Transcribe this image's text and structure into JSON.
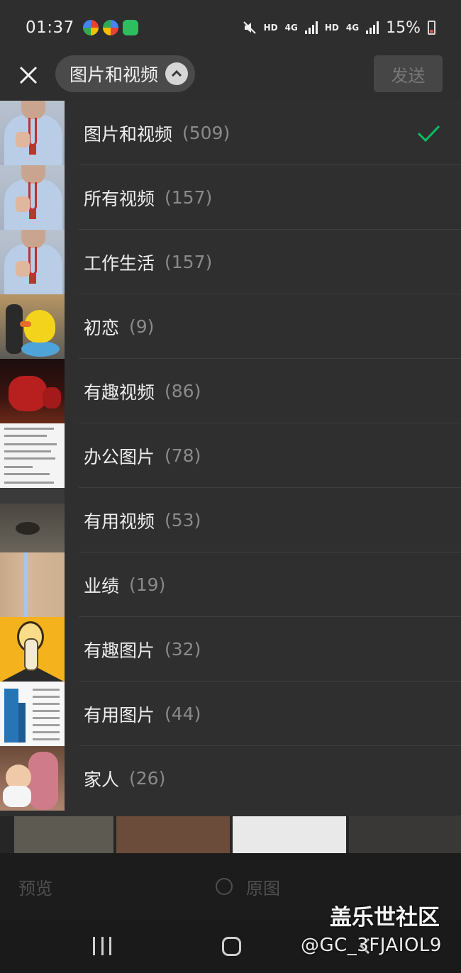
{
  "status_bar": {
    "time": "01:37",
    "sig1": "HD",
    "net1": "4G",
    "sig2": "HD",
    "net2": "4G",
    "battery": "15%"
  },
  "header": {
    "album_selector_label": "图片和视频",
    "send_label": "发送"
  },
  "albums": [
    {
      "name": "图片和视频",
      "count": "(509)",
      "selected": true,
      "thumb": "person"
    },
    {
      "name": "所有视频",
      "count": "(157)",
      "selected": false,
      "thumb": "person"
    },
    {
      "name": "工作生活",
      "count": "(157)",
      "selected": false,
      "thumb": "person"
    },
    {
      "name": "初恋",
      "count": "(9)",
      "selected": false,
      "thumb": "duck"
    },
    {
      "name": "有趣视频",
      "count": "(86)",
      "selected": false,
      "thumb": "spiderman"
    },
    {
      "name": "办公图片",
      "count": "(78)",
      "selected": false,
      "thumb": "document"
    },
    {
      "name": "有用视频",
      "count": "(53)",
      "selected": false,
      "thumb": "video"
    },
    {
      "name": "业绩",
      "count": "(19)",
      "selected": false,
      "thumb": "wood"
    },
    {
      "name": "有趣图片",
      "count": "(32)",
      "selected": false,
      "thumb": "bulb"
    },
    {
      "name": "有用图片",
      "count": "(44)",
      "selected": false,
      "thumb": "city"
    },
    {
      "name": "家人",
      "count": "(26)",
      "selected": false,
      "thumb": "family"
    }
  ],
  "bottom_toolbar": {
    "preview_label": "预览",
    "original_label": "原图"
  },
  "watermark": {
    "title": "盖乐世社区",
    "handle": "@GC_3FJAIOL9"
  },
  "colors": {
    "accent_check": "#07c160",
    "background": "#2e2e2e",
    "selector_pill": "#4a4a4a"
  }
}
